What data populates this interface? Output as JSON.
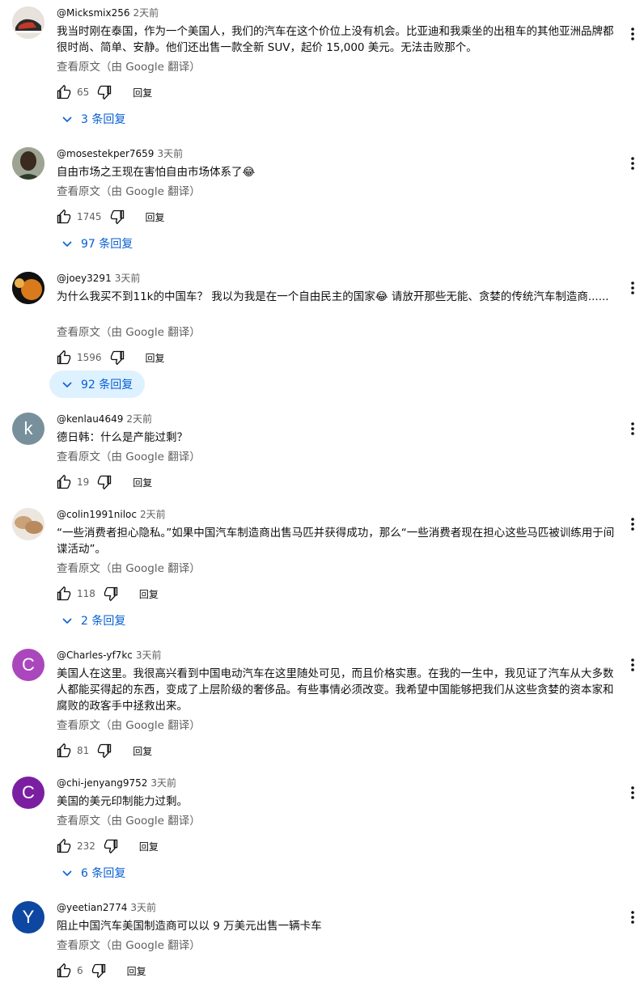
{
  "ui": {
    "translate_label": "查看原文（由 Google 翻译）",
    "reply_label": "回复",
    "reply_link_color": "#065fd4"
  },
  "comments": [
    {
      "author": "@Micksmix256",
      "time": "2天前",
      "text": "我当时刚在泰国，作为一个美国人，我们的汽车在这个价位上没有机会。比亚迪和我乘坐的出租车的其他亚洲品牌都很时尚、简单、安静。他们还出售一款全新 SUV，起价 15,000 美元。无法击败那个。",
      "likes": "65",
      "replies": "3 条回复",
      "avatar_icon": "shoe-photo-avatar"
    },
    {
      "author": "@mosestekper7659",
      "time": "3天前",
      "text": "自由市场之王现在害怕自由市场体系了😂",
      "likes": "1745",
      "replies": "97 条回复",
      "avatar_icon": "person-photo-avatar"
    },
    {
      "author": "@joey3291",
      "time": "3天前",
      "text": "为什么我买不到11k的中国车？ 我以为我是在一个自由民主的国家😂 请放开那些无能、贪婪的传统汽车制造商......",
      "likes": "1596",
      "replies": "92 条回复",
      "avatar_icon": "planets-photo-avatar"
    },
    {
      "author": "@kenlau4649",
      "time": "2天前",
      "text": "德日韩：什么是产能过剩？",
      "likes": "19",
      "replies": "",
      "avatar_letter": "k",
      "avatar_color": "#78909c"
    },
    {
      "author": "@colin1991niloc",
      "time": "2天前",
      "text": "“一些消费者担心隐私。”如果中国汽车制造商出售马匹并获得成功，那么“一些消费者现在担心这些马匹被训练用于间谍活动”。",
      "likes": "118",
      "replies": "2 条回复",
      "avatar_icon": "bread-photo-avatar"
    },
    {
      "author": "@Charles-yf7kc",
      "time": "3天前",
      "text": "美国人在这里。我很高兴看到中国电动汽车在这里随处可见，而且价格实惠。在我的一生中，我见证了汽车从大多数人都能买得起的东西，变成了上层阶级的奢侈品。有些事情必须改变。我希望中国能够把我们从这些贪婪的资本家和腐败的政客手中拯救出来。",
      "likes": "81",
      "replies": "",
      "avatar_letter": "C",
      "avatar_color": "#ab47bc"
    },
    {
      "author": "@chi-jenyang9752",
      "time": "3天前",
      "text": "美国的美元印制能力过剩。",
      "likes": "232",
      "replies": "6 条回复",
      "avatar_letter": "C",
      "avatar_color": "#7b1fa2"
    },
    {
      "author": "@yeetian2774",
      "time": "3天前",
      "text": "阻止中国汽车美国制造商可以以 9 万美元出售一辆卡车",
      "likes": "6",
      "replies": "",
      "avatar_letter": "Y",
      "avatar_color": "#0d47a1"
    }
  ]
}
